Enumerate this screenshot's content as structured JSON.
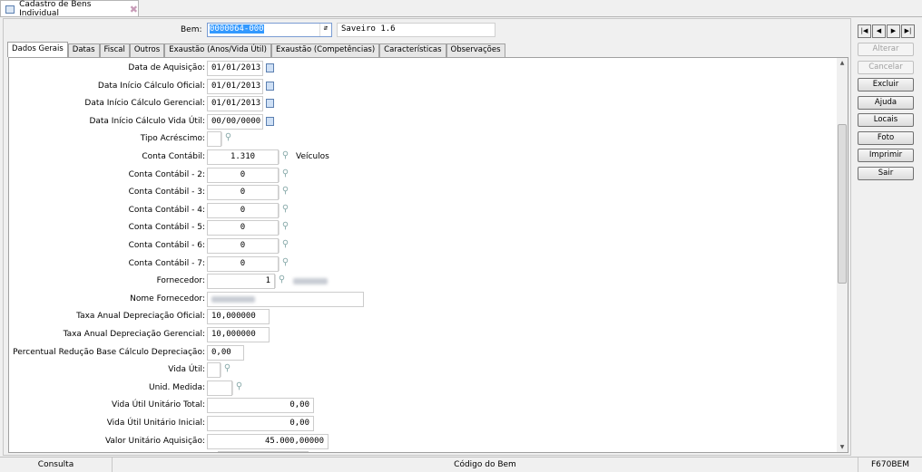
{
  "window": {
    "tab_title": "Cadastro de Bens Individual"
  },
  "bem": {
    "label": "Bem:",
    "code": "0000064-000",
    "description": "Saveiro 1.6"
  },
  "tabs": [
    "Dados Gerais",
    "Datas",
    "Fiscal",
    "Outros",
    "Exaustão (Anos/Vida Útil)",
    "Exaustão (Competências)",
    "Características",
    "Observações"
  ],
  "fields": [
    {
      "label": "Data de Aquisição:",
      "value": "01/01/2013"
    },
    {
      "label": "Data Início Cálculo Oficial:",
      "value": "01/01/2013"
    },
    {
      "label": "Data Início Cálculo Gerencial:",
      "value": "01/01/2013"
    },
    {
      "label": "Data Início Cálculo Vida Útil:",
      "value": "00/00/0000"
    },
    {
      "label": "Tipo Acréscimo:",
      "value": ""
    },
    {
      "label": "Conta Contábil:",
      "value": "1.310",
      "extra": "Veículos"
    },
    {
      "label": "Conta Contábil - 2:",
      "value": "0"
    },
    {
      "label": "Conta Contábil - 3:",
      "value": "0"
    },
    {
      "label": "Conta Contábil - 4:",
      "value": "0"
    },
    {
      "label": "Conta Contábil - 5:",
      "value": "0"
    },
    {
      "label": "Conta Contábil - 6:",
      "value": "0"
    },
    {
      "label": "Conta Contábil - 7:",
      "value": "0"
    },
    {
      "label": "Fornecedor:",
      "value": "1"
    },
    {
      "label": "Nome Fornecedor:",
      "value": ""
    },
    {
      "label": "Taxa Anual Depreciação Oficial:",
      "value": "10,000000"
    },
    {
      "label": "Taxa Anual Depreciação Gerencial:",
      "value": "10,000000"
    },
    {
      "label": "Percentual Redução Base Cálculo Depreciação:",
      "value": "0,00"
    },
    {
      "label": "Vida Útil:",
      "value": ""
    },
    {
      "label": "Unid. Medida:",
      "value": ""
    },
    {
      "label": "Vida Útil Unitário Total:",
      "value": "0,00"
    },
    {
      "label": "Vida Útil Unitário Inicial:",
      "value": "0,00"
    },
    {
      "label": "Valor Unitário Aquisição:",
      "value": "45.000,00000"
    }
  ],
  "side": {
    "buttons": [
      "Alterar",
      "Cancelar",
      "Excluir",
      "Ajuda",
      "Locais",
      "Foto",
      "Imprimir",
      "Sair"
    ]
  },
  "status": {
    "mode": "Consulta",
    "field": "Código do Bem",
    "form": "F670BEM"
  }
}
